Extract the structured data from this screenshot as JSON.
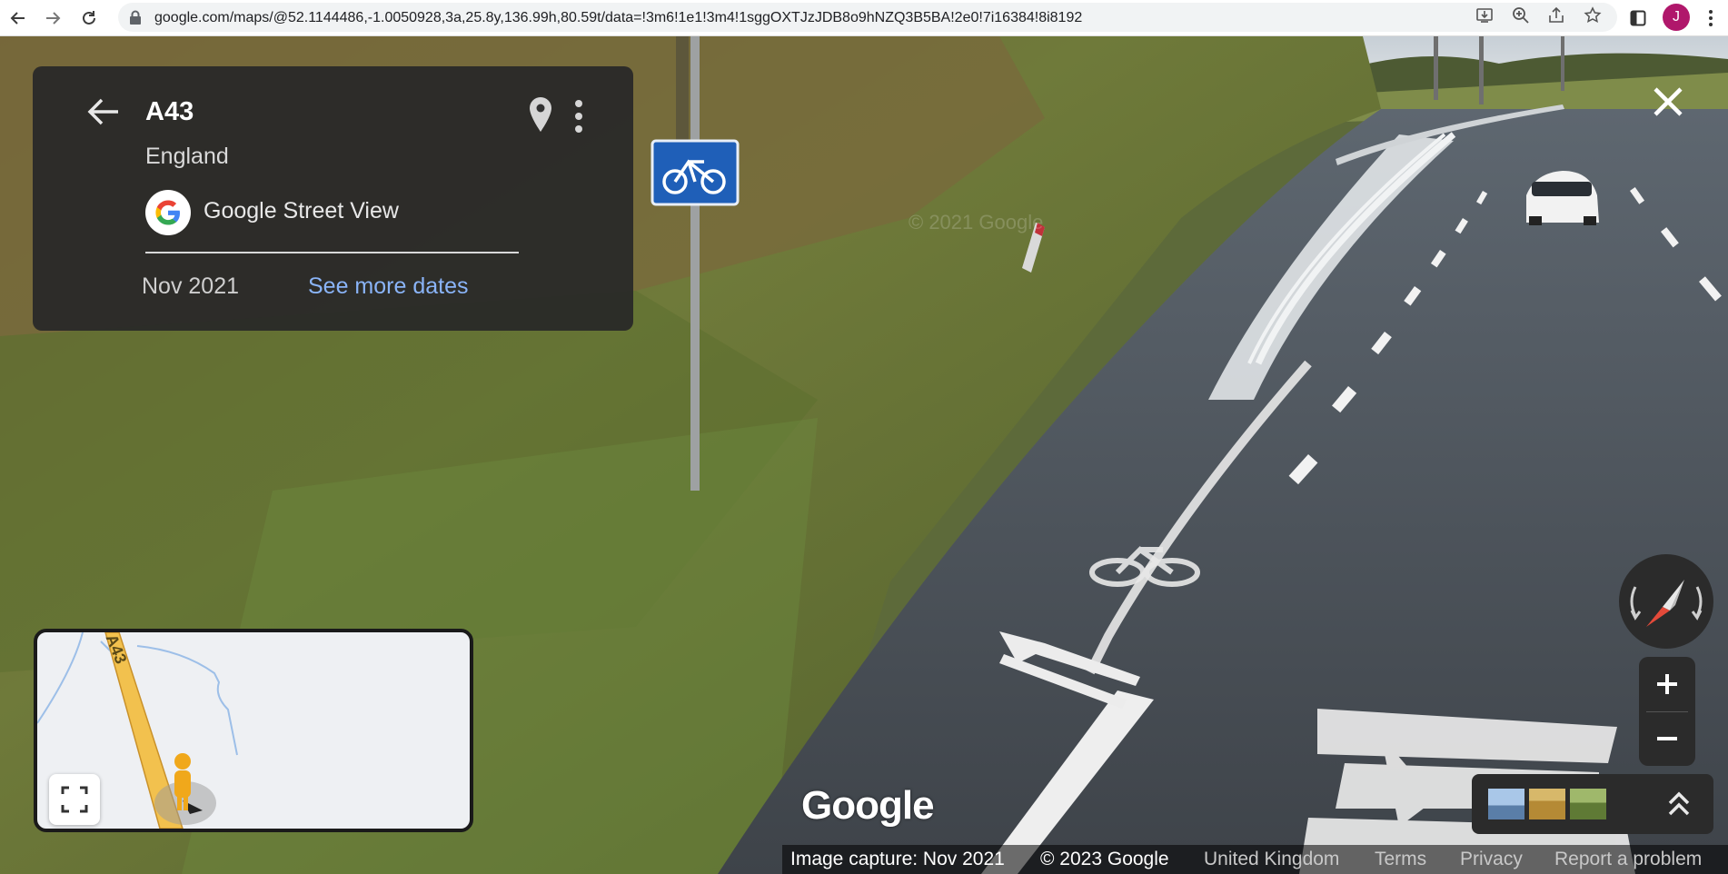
{
  "browser": {
    "url": "google.com/maps/@52.1144486,-1.0050928,3a,25.8y,136.99h,80.59t/data=!3m6!1e1!3m4!1sggOXTJzJDB8o9hNZQ3B5BA!2e0!7i16384!8i8192",
    "profile_initial": "J",
    "icons": [
      "back-icon",
      "forward-icon",
      "reload-icon",
      "lock-icon",
      "install-icon",
      "zoom-icon",
      "share-icon",
      "bookmark-star-icon",
      "side-panel-icon",
      "more-vert-icon"
    ]
  },
  "info_card": {
    "title": "A43",
    "region": "England",
    "source": "Google Street View",
    "capture_date": "Nov 2021",
    "see_more_dates": "See more dates"
  },
  "minimap": {
    "road_label": "A43"
  },
  "watermark": "Google",
  "footer": {
    "image_capture": "Image capture: Nov 2021",
    "copyright": "© 2023 Google",
    "country": "United Kingdom",
    "terms": "Terms",
    "privacy": "Privacy",
    "report": "Report a problem"
  },
  "road_marking": "A43",
  "colors": {
    "card_bg": "#282828",
    "link": "#8ab4f8",
    "avatar": "#b0176b",
    "road_map": "#f2c14e"
  }
}
